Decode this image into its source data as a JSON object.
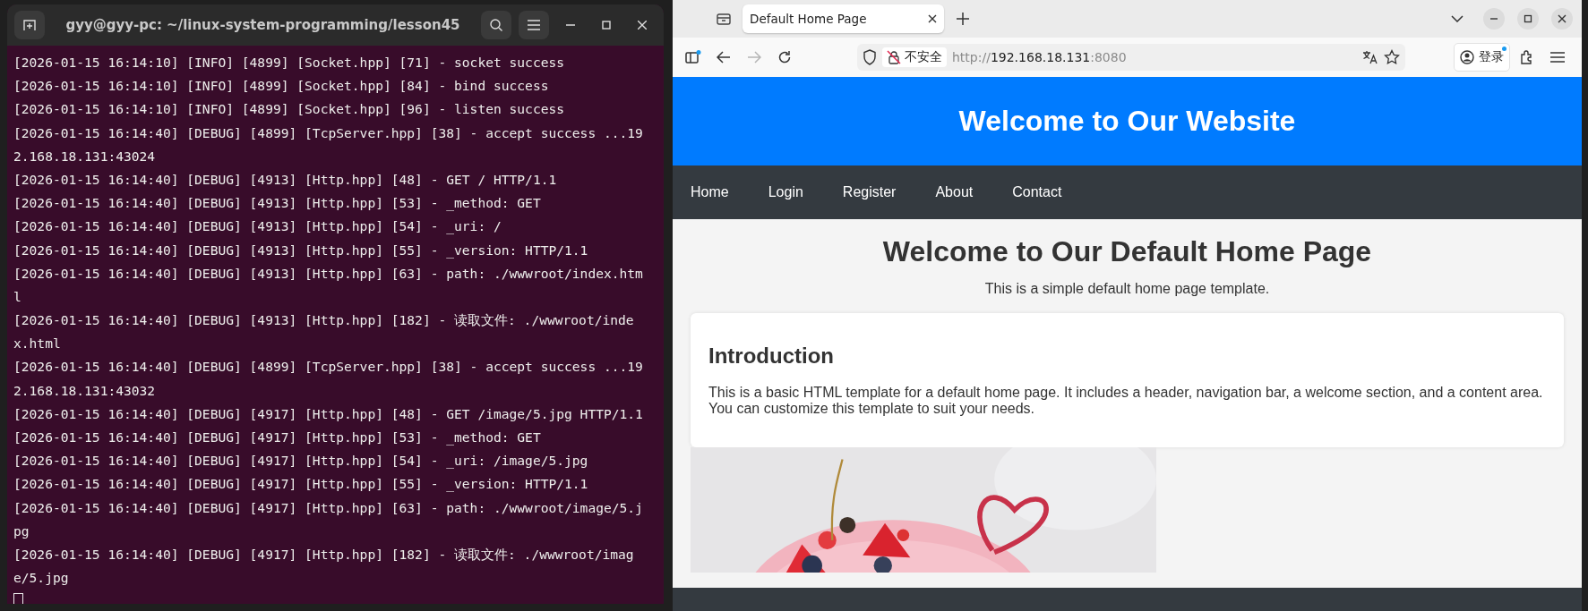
{
  "terminal": {
    "title": "gyy@gyy-pc: ~/linux-system-programming/lesson45",
    "lines": [
      "[2026-01-15 16:14:10] [INFO] [4899] [Socket.hpp] [71] - socket success",
      "[2026-01-15 16:14:10] [INFO] [4899] [Socket.hpp] [84] - bind success",
      "[2026-01-15 16:14:10] [INFO] [4899] [Socket.hpp] [96] - listen success",
      "[2026-01-15 16:14:40] [DEBUG] [4899] [TcpServer.hpp] [38] - accept success ...19",
      "2.168.18.131:43024",
      "[2026-01-15 16:14:40] [DEBUG] [4913] [Http.hpp] [48] - GET / HTTP/1.1",
      "[2026-01-15 16:14:40] [DEBUG] [4913] [Http.hpp] [53] - _method: GET",
      "[2026-01-15 16:14:40] [DEBUG] [4913] [Http.hpp] [54] - _uri: /",
      "[2026-01-15 16:14:40] [DEBUG] [4913] [Http.hpp] [55] - _version: HTTP/1.1",
      "[2026-01-15 16:14:40] [DEBUG] [4913] [Http.hpp] [63] - path: ./wwwroot/index.htm",
      "l",
      "[2026-01-15 16:14:40] [DEBUG] [4913] [Http.hpp] [182] - 读取文件: ./wwwroot/inde",
      "x.html",
      "[2026-01-15 16:14:40] [DEBUG] [4899] [TcpServer.hpp] [38] - accept success ...19",
      "2.168.18.131:43032",
      "[2026-01-15 16:14:40] [DEBUG] [4917] [Http.hpp] [48] - GET /image/5.jpg HTTP/1.1",
      "[2026-01-15 16:14:40] [DEBUG] [4917] [Http.hpp] [53] - _method: GET",
      "[2026-01-15 16:14:40] [DEBUG] [4917] [Http.hpp] [54] - _uri: /image/5.jpg",
      "[2026-01-15 16:14:40] [DEBUG] [4917] [Http.hpp] [55] - _version: HTTP/1.1",
      "[2026-01-15 16:14:40] [DEBUG] [4917] [Http.hpp] [63] - path: ./wwwroot/image/5.j",
      "pg",
      "[2026-01-15 16:14:40] [DEBUG] [4917] [Http.hpp] [182] - 读取文件: ./wwwroot/imag",
      "e/5.jpg"
    ]
  },
  "browser": {
    "tabs": [
      {
        "title": "Default Home Page",
        "selected": true
      }
    ],
    "forward": {
      "disabled": true
    },
    "security_label": "不安全",
    "url": {
      "scheme": "http://",
      "host": "192.168.18.131",
      "port": ":8080"
    },
    "account_button": "登录",
    "page": {
      "header_title": "Welcome to Our Website",
      "nav": [
        {
          "label": "Home"
        },
        {
          "label": "Login"
        },
        {
          "label": "Register"
        },
        {
          "label": "About"
        },
        {
          "label": "Contact"
        }
      ],
      "heading": "Welcome to Our Default Home Page",
      "subtitle": "This is a simple default home page template.",
      "card": {
        "title": "Introduction",
        "text": "This is a basic HTML template for a default home page. It includes a header, navigation bar, a welcome section, and a content area. You can customize this template to suit your needs."
      }
    }
  }
}
